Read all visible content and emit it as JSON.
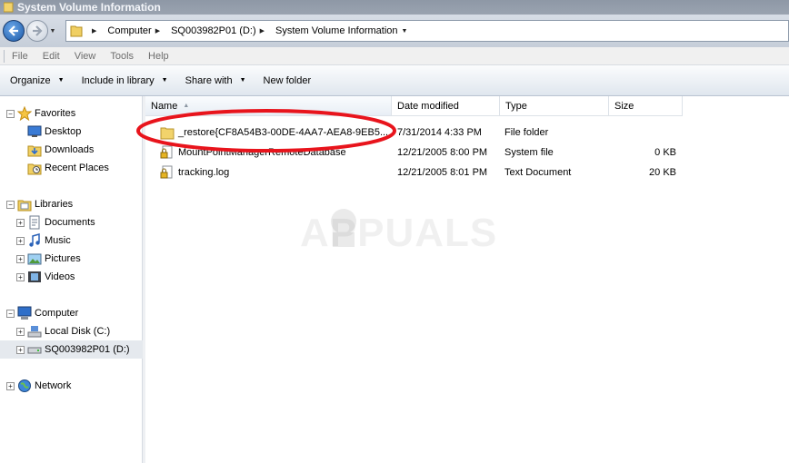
{
  "window": {
    "title": "System Volume Information"
  },
  "address": {
    "breadcrumbs": [
      {
        "label": "Computer"
      },
      {
        "label": "SQ003982P01 (D:)"
      },
      {
        "label": "System Volume Information"
      }
    ]
  },
  "menu": {
    "items": [
      "File",
      "Edit",
      "View",
      "Tools",
      "Help"
    ]
  },
  "commands": {
    "organize": "Organize",
    "include_in_library": "Include in library",
    "share_with": "Share with",
    "new_folder": "New folder"
  },
  "nav": {
    "favorites": {
      "label": "Favorites",
      "items": [
        "Desktop",
        "Downloads",
        "Recent Places"
      ]
    },
    "libraries": {
      "label": "Libraries",
      "items": [
        "Documents",
        "Music",
        "Pictures",
        "Videos"
      ]
    },
    "computer": {
      "label": "Computer",
      "items": [
        "Local Disk (C:)",
        "SQ003982P01 (D:)"
      ],
      "selected": "SQ003982P01 (D:)"
    },
    "network": {
      "label": "Network"
    }
  },
  "columns": {
    "name": "Name",
    "date": "Date modified",
    "type": "Type",
    "size": "Size"
  },
  "files": [
    {
      "name": "_restore{CF8A54B3-00DE-4AA7-AEA8-9EB5...",
      "date": "7/31/2014 4:33 PM",
      "type": "File folder",
      "size": "",
      "icon": "folder-icon"
    },
    {
      "name": "MountPointManagerRemoteDatabase",
      "date": "12/21/2005 8:00 PM",
      "type": "System file",
      "size": "0 KB",
      "icon": "locked-file-icon"
    },
    {
      "name": "tracking.log",
      "date": "12/21/2005 8:01 PM",
      "type": "Text Document",
      "size": "20 KB",
      "icon": "locked-file-icon"
    }
  ],
  "watermark": {
    "text": "APPUALS"
  },
  "annotation": {
    "color": "#e8141c"
  }
}
